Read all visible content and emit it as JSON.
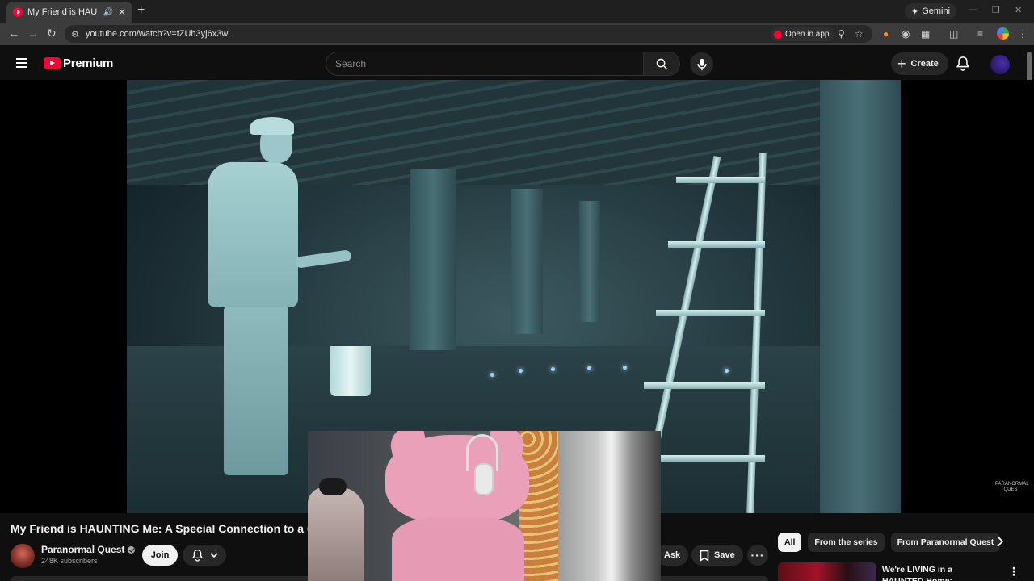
{
  "browser": {
    "tab_title": "My Friend is HAUNTING Me: A Special Connection to a Ghost",
    "new_tab_symbol": "+",
    "gemini_label": "Gemini",
    "url": "youtube.com/watch?v=tZUh3yj6x3w",
    "open_in_app_label": "Open in app"
  },
  "masthead": {
    "brand": "Premium",
    "search_placeholder": "Search",
    "create_label": "Create"
  },
  "video": {
    "watermark_line1": "PARANORMAL",
    "watermark_line2": "QUEST"
  },
  "details": {
    "title": "My Friend is HAUNTING Me: A Special Connection to a G",
    "channel_name": "Paranormal Quest",
    "subscribers": "248K subscribers",
    "join_label": "Join",
    "ask_label": "Ask",
    "save_label": "Save"
  },
  "sidebar": {
    "chips": [
      "All",
      "From the series",
      "From Paranormal Quest"
    ],
    "recommendation_title": "We're LIVING in a HAUNTED Home: Paranormal Activity"
  },
  "colors": {
    "accent": "#ff0033",
    "background": "#0f0f0f",
    "chip_bg": "#272727"
  },
  "icons": [
    "back-icon",
    "forward-icon",
    "reload-icon",
    "search-icon",
    "mic-icon",
    "bell-icon",
    "bookmark-icon",
    "star-icon",
    "zoom-icon",
    "extensions-icon",
    "chevron-right-icon"
  ]
}
